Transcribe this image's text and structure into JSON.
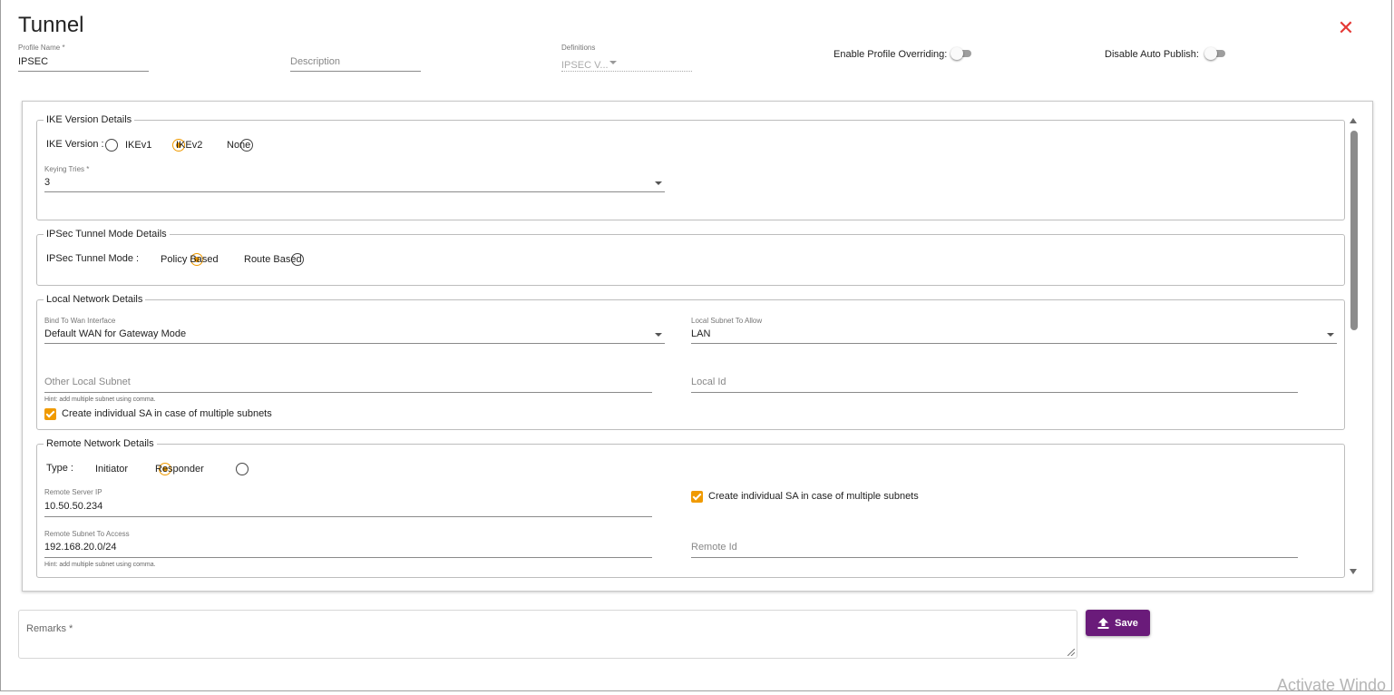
{
  "dialog": {
    "title": "Tunnel",
    "close_icon": "close-icon"
  },
  "header": {
    "profile_name": {
      "label": "Profile Name *",
      "value": "IPSEC"
    },
    "description": {
      "placeholder": "Description"
    },
    "definitions": {
      "label": "Definitions",
      "value": "IPSEC V..."
    },
    "enable_profile_overriding": {
      "label": "Enable Profile Overriding:",
      "on": false
    },
    "disable_auto_publish": {
      "label": "Disable Auto Publish:",
      "on": false
    }
  },
  "ike": {
    "legend": "IKE Version Details",
    "version_label": "IKE Version :",
    "options": [
      "IKEv1",
      "IKEv2",
      "None"
    ],
    "selected": "IKEv2",
    "keying_tries": {
      "label": "Keying Tries *",
      "value": "3"
    }
  },
  "ipsec": {
    "legend": "IPSec Tunnel Mode Details",
    "mode_label": "IPSec Tunnel Mode :",
    "options": [
      "Policy Based",
      "Route Based"
    ],
    "selected": "Policy Based"
  },
  "local": {
    "legend": "Local Network Details",
    "bind_wan": {
      "label": "Bind To Wan Interface",
      "value": "Default WAN for Gateway Mode"
    },
    "local_subnet": {
      "label": "Local Subnet To Allow",
      "value": "LAN"
    },
    "other_subnet": {
      "placeholder": "Other Local Subnet"
    },
    "local_id": {
      "placeholder": "Local Id"
    },
    "hint": "Hint: add multiple subnet using comma.",
    "individual_sa": {
      "label": "Create individual SA in case of multiple subnets",
      "checked": true
    }
  },
  "remote": {
    "legend": "Remote Network Details",
    "type_label": "Type :",
    "options": [
      "Initiator",
      "Responder"
    ],
    "selected": "Initiator",
    "server_ip": {
      "label": "Remote Server IP",
      "value": "10.50.50.234"
    },
    "individual_sa": {
      "label": "Create individual SA in case of multiple subnets",
      "checked": true
    },
    "subnet_access": {
      "label": "Remote Subnet To Access",
      "value": "192.168.20.0/24"
    },
    "remote_id": {
      "placeholder": "Remote Id"
    },
    "hint": "Hint: add multiple subnet using comma."
  },
  "footer": {
    "remarks_placeholder": "Remarks *",
    "save_label": "Save",
    "save_icon": "upload-icon"
  },
  "watermark": "Activate Windo",
  "colors": {
    "accent": "#f09a00",
    "save_button": "#6a1b7a",
    "close": "#e53935"
  }
}
